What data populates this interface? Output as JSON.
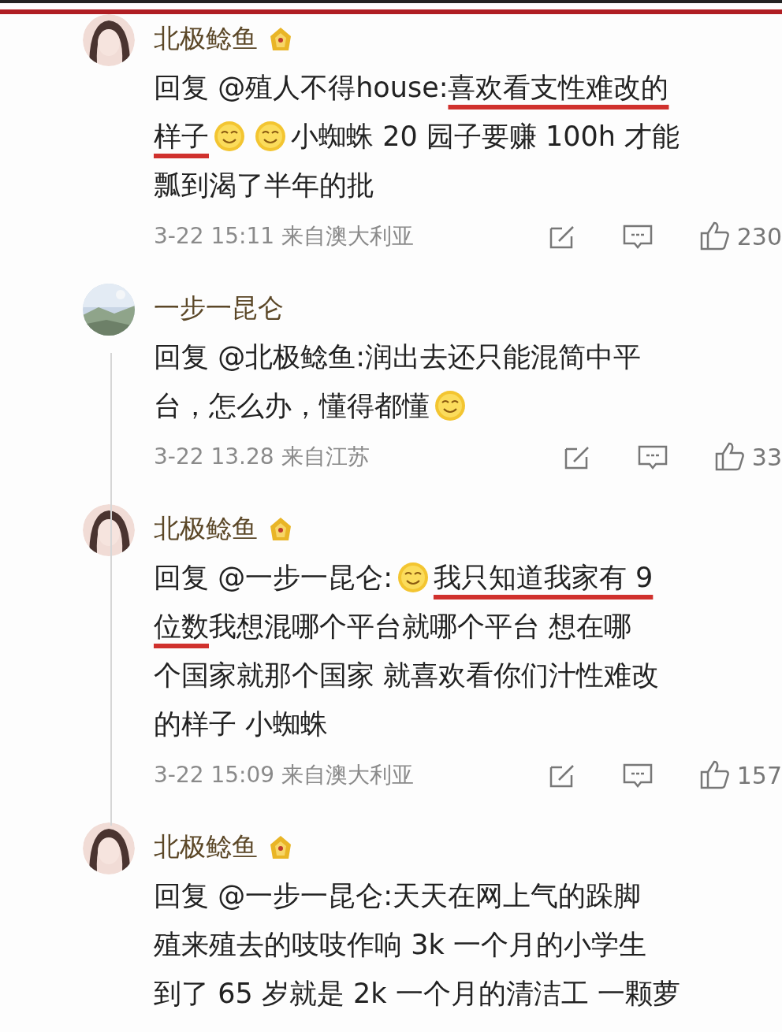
{
  "comments": [
    {
      "avatar": {
        "kind": "person"
      },
      "name": "北极鲶鱼",
      "badge": true,
      "lines": [
        [
          {
            "kind": "text",
            "text": "回复 @殖人不得house:",
            "underlined": false
          },
          {
            "kind": "text",
            "text": "喜欢看支性难改的",
            "underlined": true
          }
        ],
        [
          {
            "kind": "text",
            "text": "样子",
            "underlined": true
          },
          {
            "kind": "emoji"
          },
          {
            "kind": "emoji"
          },
          {
            "kind": "text",
            "text": "小蜘蛛 20 园子要赚 100h 才能",
            "underlined": false
          }
        ],
        [
          {
            "kind": "text",
            "text": "瓢到渴了半年的批",
            "underlined": false
          }
        ]
      ],
      "meta": "3-22 15:11  来自澳大利亚",
      "likes": "230"
    },
    {
      "avatar": {
        "kind": "picture"
      },
      "name": "一步一昆仑",
      "badge": false,
      "lines": [
        [
          {
            "kind": "text",
            "text": "回复 @北极鲶鱼:润出去还只能混简中平",
            "underlined": false
          }
        ],
        [
          {
            "kind": "text",
            "text": "台，怎么办，懂得都懂",
            "underlined": false
          },
          {
            "kind": "emoji"
          }
        ]
      ],
      "meta": "3-22 13.28  来自江苏",
      "likes": "33"
    },
    {
      "avatar": {
        "kind": "person"
      },
      "name": "北极鲶鱼",
      "badge": true,
      "lines": [
        [
          {
            "kind": "text",
            "text": "回复 @一步一昆仑:",
            "underlined": false
          },
          {
            "kind": "emoji"
          },
          {
            "kind": "text",
            "text": "我只知道我家有 9",
            "underlined": true
          }
        ],
        [
          {
            "kind": "text",
            "text": "位数",
            "underlined": true
          },
          {
            "kind": "text",
            "text": " 我想混哪个平台就哪个平台 想在哪",
            "underlined": false
          }
        ],
        [
          {
            "kind": "text",
            "text": "个国家就那个国家 就喜欢看你们汁性难改",
            "underlined": false
          }
        ],
        [
          {
            "kind": "text",
            "text": "的样子 小蜘蛛",
            "underlined": false
          }
        ]
      ],
      "meta": "3-22 15:09  来自澳大利亚",
      "likes": "157"
    },
    {
      "avatar": {
        "kind": "person"
      },
      "name": "北极鲶鱼",
      "badge": true,
      "lines": [
        [
          {
            "kind": "text",
            "text": "回复 @一步一昆仑:天天在网上气的跺脚",
            "underlined": false
          }
        ],
        [
          {
            "kind": "text",
            "text": "殖来殖去的吱吱作响 3k 一个月的小学生",
            "underlined": false
          }
        ],
        [
          {
            "kind": "text",
            "text": "到了 65 岁就是 2k 一个月的清洁工 一颗萝",
            "underlined": false
          }
        ]
      ]
    }
  ]
}
